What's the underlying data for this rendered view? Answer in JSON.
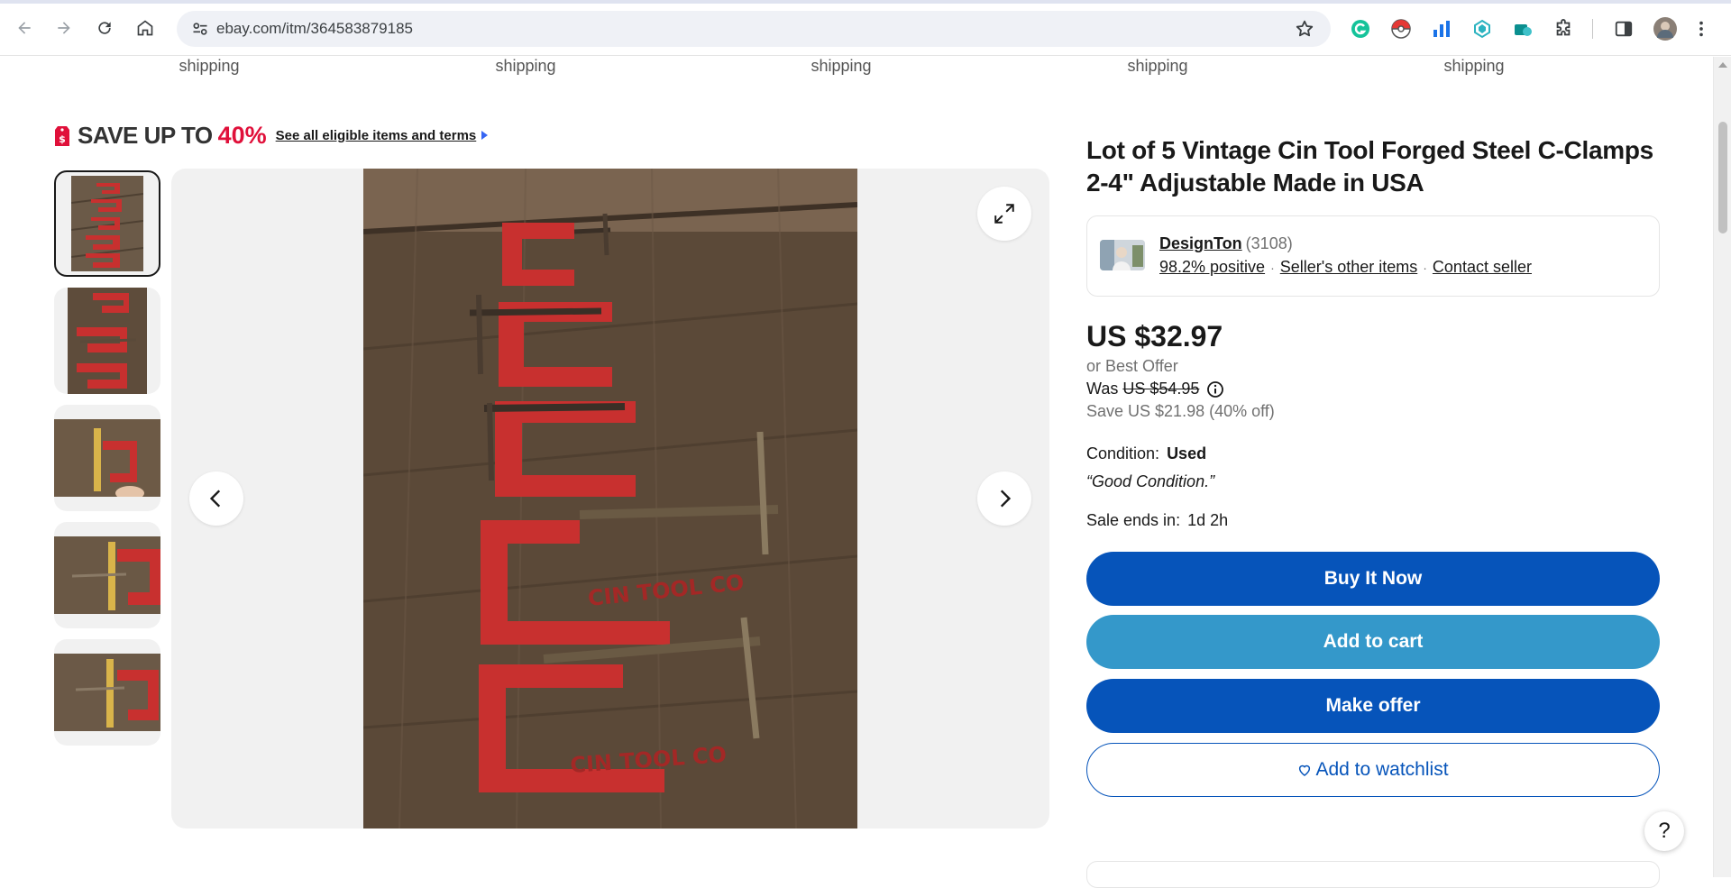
{
  "browser": {
    "url": "ebay.com/itm/364583879185"
  },
  "shipping_labels": [
    "shipping",
    "shipping",
    "shipping",
    "shipping",
    "shipping"
  ],
  "promo": {
    "save_text": "SAVE UP TO",
    "percent": "40%",
    "link_text": "See all eligible items and terms"
  },
  "listing": {
    "title": "Lot of 5 Vintage Cin Tool Forged Steel C-Clamps 2-4\" Adjustable Made in USA",
    "seller": {
      "name": "DesignTon",
      "feedback_count": "(3108)",
      "positive": "98.2% positive",
      "other_items": "Seller's other items",
      "contact": "Contact seller"
    },
    "price": "US $32.97",
    "best_offer": "or Best Offer",
    "was_label": "Was",
    "was_price": "US $54.95",
    "saving": "Save US $21.98 (40% off)",
    "condition_label": "Condition:",
    "condition_value": "Used",
    "condition_quote": "“Good Condition.”",
    "sale_ends_label": "Sale ends in:",
    "sale_ends_value": "1d 2h"
  },
  "actions": {
    "buy_now": "Buy It Now",
    "add_to_cart": "Add to cart",
    "make_offer": "Make offer",
    "watchlist": "Add to watchlist"
  },
  "help_label": "?",
  "colors": {
    "primary_blue": "#0654ba",
    "cart_blue": "#3498ca",
    "promo_red": "#e0103a",
    "clamp_red": "#c8302f"
  }
}
